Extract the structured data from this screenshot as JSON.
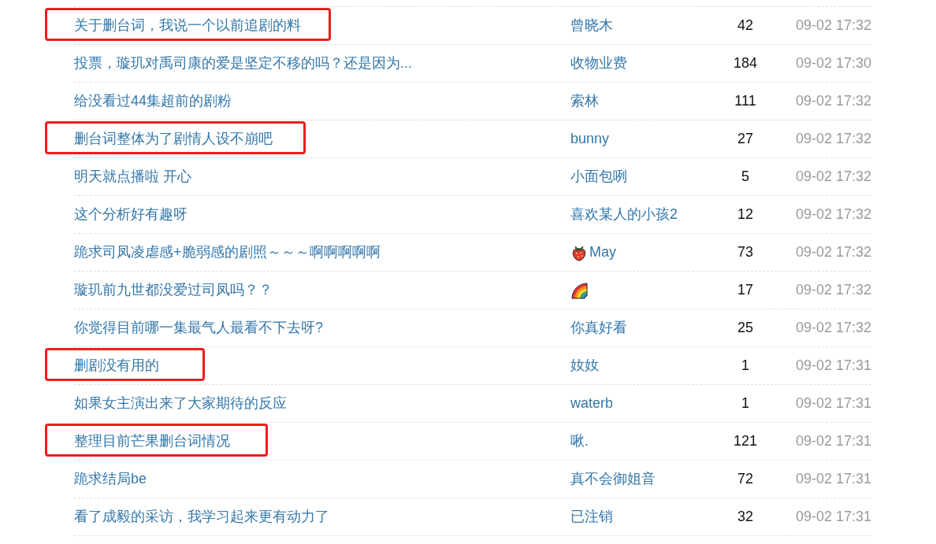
{
  "topics": [
    {
      "title": "关于删台词，我说一个以前追剧的料",
      "author": "曾晓木",
      "replies": "42",
      "time": "09-02 17:32",
      "highlighted": true
    },
    {
      "title": "投票，璇玑对禹司康的爱是坚定不移的吗？还是因为...",
      "author": "收物业费",
      "replies": "184",
      "time": "09-02 17:30",
      "highlighted": false
    },
    {
      "title": "给没看过44集超前的剧粉",
      "author": "索林",
      "replies": "111",
      "time": "09-02 17:32",
      "highlighted": false
    },
    {
      "title": "删台词整体为了剧情人设不崩吧",
      "author": "bunny",
      "replies": "27",
      "time": "09-02 17:32",
      "highlighted": true
    },
    {
      "title": "明天就点播啦 开心",
      "author": "小面包咧",
      "replies": "5",
      "time": "09-02 17:32",
      "highlighted": false
    },
    {
      "title": "这个分析好有趣呀",
      "author": "喜欢某人的小孩2",
      "replies": "12",
      "time": "09-02 17:32",
      "highlighted": false
    },
    {
      "title": "跪求司凤凌虐感+脆弱感的剧照～～～啊啊啊啊啊",
      "author": "May",
      "author_icon": {
        "kind": "strawberry"
      },
      "replies": "73",
      "time": "09-02 17:32",
      "highlighted": false
    },
    {
      "title": "璇玑前九世都没爱过司凤吗？？",
      "author_icon": {
        "kind": "rainbow"
      },
      "replies": "17",
      "time": "09-02 17:32",
      "highlighted": false
    },
    {
      "title": "你觉得目前哪一集最气人最看不下去呀?",
      "author": "你真好看",
      "replies": "25",
      "time": "09-02 17:32",
      "highlighted": false
    },
    {
      "title": "删剧没有用的",
      "author": "奻奻",
      "replies": "1",
      "time": "09-02 17:31",
      "highlighted": true
    },
    {
      "title": "如果女主演出来了大家期待的反应",
      "author": "waterb",
      "replies": "1",
      "time": "09-02 17:31",
      "highlighted": false
    },
    {
      "title": "整理目前芒果删台词情况",
      "author": "啾.",
      "replies": "121",
      "time": "09-02 17:31",
      "highlighted": true
    },
    {
      "title": "跪求结局be",
      "author": "真不会御姐音",
      "replies": "72",
      "time": "09-02 17:31",
      "highlighted": false
    },
    {
      "title": "看了成毅的采访，我学习起来更有动力了",
      "author": "已注销",
      "replies": "32",
      "time": "09-02 17:31",
      "highlighted": false
    }
  ]
}
